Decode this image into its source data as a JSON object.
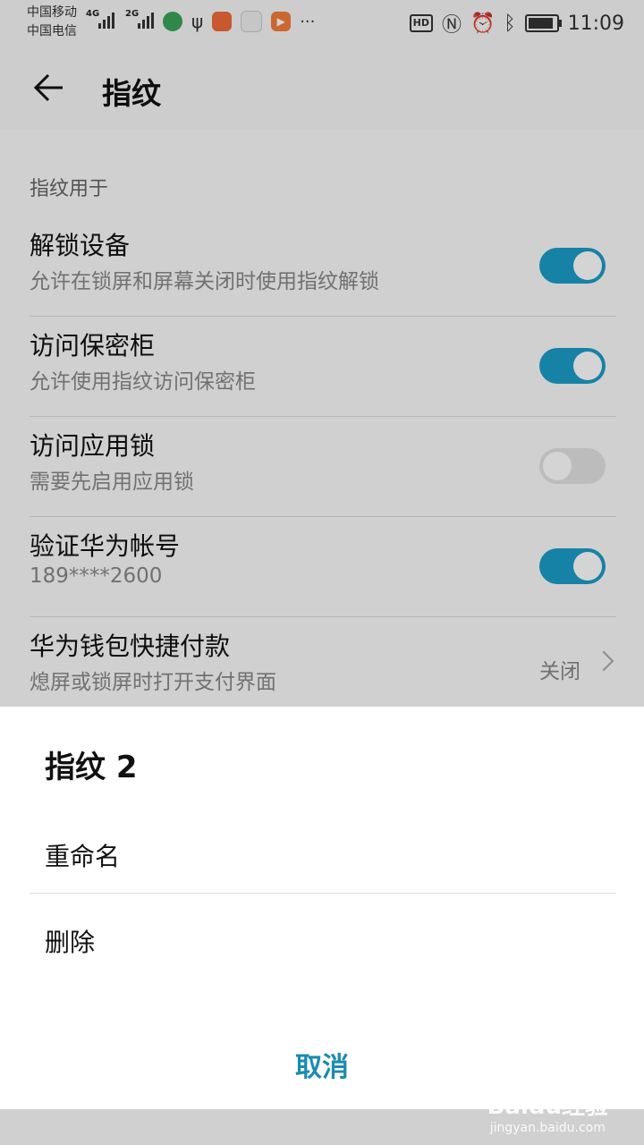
{
  "status_bar": {
    "carrier_1": "中国移动",
    "carrier_2": "中国电信",
    "net_1": "4G",
    "net_2": "2G",
    "time": "11:09",
    "hd": "HD"
  },
  "header": {
    "title": "指纹"
  },
  "section_label": "指纹用于",
  "settings": [
    {
      "title": "解锁设备",
      "subtitle": "允许在锁屏和屏幕关闭时使用指纹解锁",
      "toggle": "on"
    },
    {
      "title": "访问保密柜",
      "subtitle": "允许使用指纹访问保密柜",
      "toggle": "on"
    },
    {
      "title": "访问应用锁",
      "subtitle": "需要先启用应用锁",
      "toggle": "off"
    },
    {
      "title": "验证华为帐号",
      "subtitle": "189****2600",
      "toggle": "on"
    },
    {
      "title": "华为钱包快捷付款",
      "subtitle": "熄屏或锁屏时打开支付界面",
      "value": "关闭"
    }
  ],
  "sheet": {
    "title": "指纹 2",
    "rename": "重命名",
    "delete": "删除",
    "cancel": "取消"
  },
  "watermark": {
    "brand": "Baidu经验",
    "url": "jingyan.baidu.com"
  },
  "colors": {
    "accent": "#1b9dc7",
    "cancel": "#1b8bb0"
  }
}
